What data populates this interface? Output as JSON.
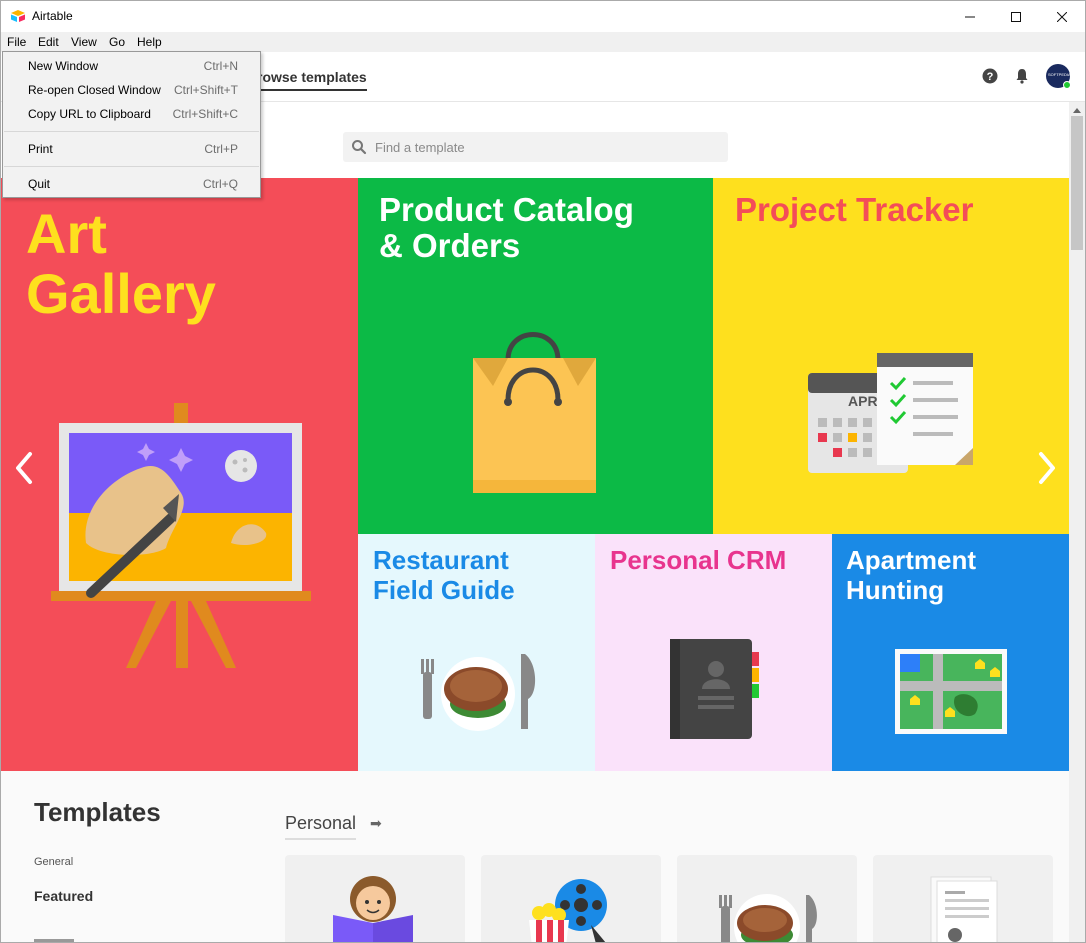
{
  "window": {
    "title": "Airtable",
    "minimize_glyph": "—",
    "maximize_glyph": "☐",
    "close_glyph": "✕"
  },
  "menubar": {
    "items": [
      {
        "label": "File"
      },
      {
        "label": "Edit"
      },
      {
        "label": "View"
      },
      {
        "label": "Go"
      },
      {
        "label": "Help"
      }
    ]
  },
  "file_menu": {
    "items": [
      {
        "label": "New Window",
        "shortcut": "Ctrl+N"
      },
      {
        "label": "Re-open Closed Window",
        "shortcut": "Ctrl+Shift+T"
      },
      {
        "label": "Copy URL to Clipboard",
        "shortcut": "Ctrl+Shift+C"
      },
      {
        "label": "Print",
        "shortcut": "Ctrl+P"
      },
      {
        "label": "Quit",
        "shortcut": "Ctrl+Q"
      }
    ]
  },
  "header": {
    "active_tab": "rowse templates",
    "icons": [
      "help-icon",
      "bell-icon",
      "avatar"
    ],
    "avatar_text": "SOFTPEDIA"
  },
  "search": {
    "placeholder": "Find a template"
  },
  "featured_tiles": [
    {
      "title_line1": "Art",
      "title_line2": "Gallery",
      "bg": "#f44d58",
      "fg": "#fee01e"
    },
    {
      "title_line1": "Product Catalog",
      "title_line2": "& Orders",
      "bg": "#0cba46",
      "fg": "#ffffff"
    },
    {
      "title_line1": "Project Tracker",
      "title_line2": "",
      "bg": "#fee01e",
      "fg": "#f44d58",
      "calendar_text": "APR"
    },
    {
      "title_line1": "Restaurant",
      "title_line2": "Field Guide",
      "bg": "#e5f8fd",
      "fg": "#1a8ae6"
    },
    {
      "title_line1": "Personal CRM",
      "title_line2": "",
      "bg": "#fae2fa",
      "fg": "#e8348e"
    },
    {
      "title_line1": "Apartment",
      "title_line2": "Hunting",
      "bg": "#1a8ae6",
      "fg": "#ffffff"
    }
  ],
  "carousel": {
    "prev_icon": "chevron-left-icon",
    "next_icon": "chevron-right-icon"
  },
  "templates_section": {
    "heading": "Templates",
    "sidebar_group": "General",
    "sidebar_item": "Featured",
    "category": "Personal",
    "category_arrow": "➡"
  }
}
